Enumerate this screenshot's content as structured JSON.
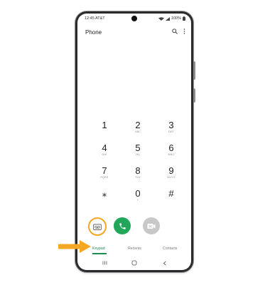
{
  "status": {
    "time": "12:45 AT&T",
    "battery": "100%"
  },
  "header": {
    "title": "Phone",
    "search_icon": "search-icon",
    "more_icon": "more-vertical-icon"
  },
  "keypad": {
    "rows": [
      [
        {
          "digit": "1",
          "letters": ""
        },
        {
          "digit": "2",
          "letters": "ABC"
        },
        {
          "digit": "3",
          "letters": "DEF"
        }
      ],
      [
        {
          "digit": "4",
          "letters": "GHI"
        },
        {
          "digit": "5",
          "letters": "JKL"
        },
        {
          "digit": "6",
          "letters": "MNO"
        }
      ],
      [
        {
          "digit": "7",
          "letters": "PQRS"
        },
        {
          "digit": "8",
          "letters": "TUV"
        },
        {
          "digit": "9",
          "letters": "WXYZ"
        }
      ],
      [
        {
          "digit": "⁎",
          "letters": ""
        },
        {
          "digit": "0",
          "letters": "+"
        },
        {
          "digit": "#",
          "letters": ""
        }
      ]
    ]
  },
  "actions": {
    "voicemail_icon": "voicemail-icon",
    "call_icon": "phone-icon",
    "video_icon": "video-call-icon"
  },
  "tabs": [
    {
      "label": "Keypad",
      "active": true
    },
    {
      "label": "Recents",
      "active": false
    },
    {
      "label": "Contacts",
      "active": false
    }
  ],
  "colors": {
    "accent": "#1e8f4e",
    "call_button": "#22a65a",
    "highlight": "#f5a623",
    "disabled_button": "#c8c8c8"
  }
}
